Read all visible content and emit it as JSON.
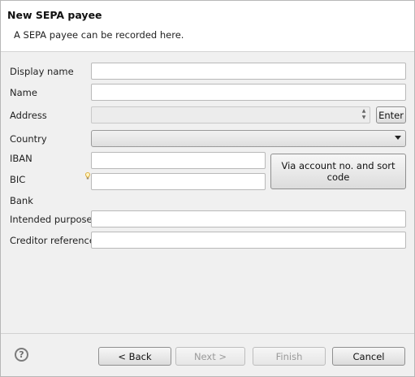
{
  "header": {
    "title": "New SEPA payee",
    "subtitle": "A SEPA payee can be recorded here."
  },
  "form": {
    "display_name_label": "Display name",
    "display_name_value": "",
    "name_label": "Name",
    "name_value": "",
    "address_label": "Address",
    "address_value": "",
    "enter_button": "Enter",
    "country_label": "Country",
    "country_value": "",
    "iban_label": "IBAN",
    "iban_value": "",
    "bic_label": "BIC",
    "bic_value": "",
    "via_account_button": "Via account no. and sort code",
    "bank_label": "Bank",
    "intended_purpose_label": "Intended purpose",
    "intended_purpose_value": "",
    "creditor_reference_label": "Creditor reference",
    "creditor_reference_value": ""
  },
  "footer": {
    "help_glyph": "?",
    "back_label": "< Back",
    "next_label": "Next >",
    "finish_label": "Finish",
    "cancel_label": "Cancel"
  },
  "icons": {
    "help": "help-icon",
    "hint": "lightbulb-icon",
    "dropdown": "chevron-down-icon",
    "spinner": "spinner-arrows-icon"
  }
}
